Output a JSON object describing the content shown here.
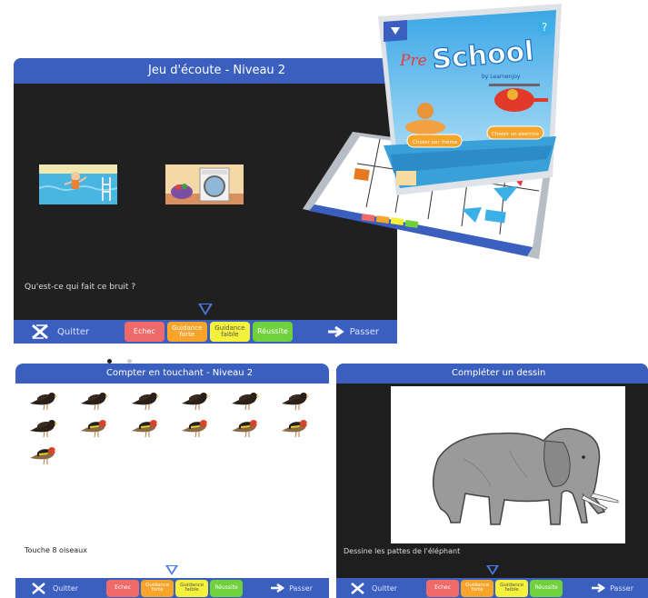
{
  "panel1": {
    "title": "Jeu d'écoute - Niveau 2",
    "question": "Qu'est-ce qui fait ce bruit ?",
    "footer": {
      "quit": "Quitter",
      "fail": "Echec",
      "strong": "Guidance forte",
      "weak": "Guidance faible",
      "success": "Réussite",
      "skip": "Passer"
    }
  },
  "panel2": {
    "title": "Compter en touchant - Niveau 2",
    "instruction": "Touche 8 oiseaux",
    "footer": {
      "quit": "Quitter",
      "fail": "Echec",
      "strong": "Guidance forte",
      "weak": "Guidance faible",
      "success": "Réussite",
      "skip": "Passer"
    }
  },
  "panel3": {
    "title": "Compléter un dessin",
    "instruction": "Dessine les pattes de l'éléphant",
    "footer": {
      "quit": "Quitter",
      "fail": "Echec",
      "strong": "Guidance forte",
      "weak": "Guidance faible",
      "success": "Réussite",
      "skip": "Passer"
    }
  },
  "tablet": {
    "logo_pre": "Pre",
    "logo_school": "School",
    "logo_by": "by Learnenjoy",
    "help": "?",
    "btn_left": "Choisir par thème",
    "btn_right": "Choisir un exercice"
  },
  "colors": {
    "header": "#3a5fbf",
    "fail": "#f06a6a",
    "strong": "#f6a42a",
    "weak": "#f4f13a",
    "success": "#6fd13b",
    "dark_bg": "#1e1e1e"
  }
}
